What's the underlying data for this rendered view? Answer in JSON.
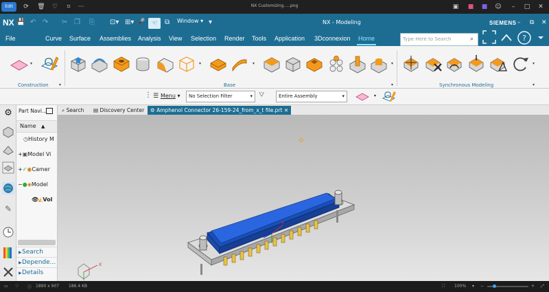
{
  "viewer": {
    "edit_label": "Edit",
    "file_title": "NX Customizing.....png",
    "resolution": "1890 x 907",
    "file_size": "186.4 KB",
    "zoom": "100%"
  },
  "nx": {
    "logo": "NX",
    "window_menu": "Window",
    "app_title": "NX - Modeling",
    "brand": "SIEMENS",
    "search_placeholder": "Type Here to Search"
  },
  "menu": {
    "items": [
      "File",
      "Curve",
      "Surface",
      "Assemblies",
      "Analysis",
      "View",
      "Selection",
      "Render",
      "Tools",
      "Application",
      "3Dconnexion",
      "Home"
    ],
    "active": "Home"
  },
  "ribbon": {
    "groups": [
      "Construction",
      "Base",
      "Synchronous Modeling"
    ]
  },
  "selection_bar": {
    "menu_label": "Menu",
    "filter_value": "No Selection Filter",
    "scope_value": "Entire Assembly"
  },
  "tabs": [
    {
      "label": "Search"
    },
    {
      "label": "Discovery Center"
    },
    {
      "label": "Amphenol Connector 26-159-24_from_x_t file.prt"
    }
  ],
  "part_navigator": {
    "title": "Part Navi...",
    "column": "Name",
    "nodes": [
      "History M",
      "Model Vi",
      "Camer",
      "Model",
      "Vol"
    ],
    "sections": [
      "Search",
      "Depende...",
      "Details"
    ]
  },
  "colors": {
    "accent": "#1d6d93",
    "model_blue": "#1f5fd8",
    "ribbon_orange": "#f39a1e"
  }
}
